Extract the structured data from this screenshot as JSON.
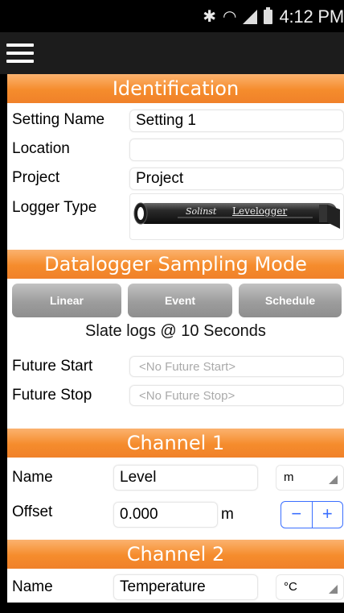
{
  "status": {
    "time": "4:12 PM",
    "icons": [
      "bluetooth-icon",
      "wifi-icon",
      "signal-icon",
      "battery-icon"
    ]
  },
  "app_bar": {
    "menu_icon": "hamburger-menu-icon"
  },
  "identification": {
    "header": "Identification",
    "setting_name_label": "Setting Name",
    "setting_name_value": "Setting 1",
    "location_label": "Location",
    "location_value": "",
    "project_label": "Project",
    "project_value": "Project",
    "logger_type_label": "Logger Type",
    "logger_brand": "Solinst",
    "logger_model": "Levelogger"
  },
  "sampling": {
    "header": "Datalogger Sampling Mode",
    "buttons": [
      "Linear",
      "Event",
      "Schedule"
    ],
    "summary": "Slate logs @  10 Seconds",
    "future_start_label": "Future Start",
    "future_start_placeholder": "<No Future Start>",
    "future_stop_label": "Future Stop",
    "future_stop_placeholder": "<No Future Stop>"
  },
  "channel1": {
    "header": "Channel 1",
    "name_label": "Name",
    "name_value": "Level",
    "unit_select": "m",
    "offset_label": "Offset",
    "offset_value": "0.000",
    "offset_unit": "m",
    "minus": "−",
    "plus": "+"
  },
  "channel2": {
    "header": "Channel 2",
    "name_label": "Name",
    "name_value": "Temperature",
    "unit_select": "°C"
  },
  "colors": {
    "header_orange": "#f58c2c",
    "stepper_blue": "#3b6fff",
    "button_gray": "#9d9d9d"
  }
}
